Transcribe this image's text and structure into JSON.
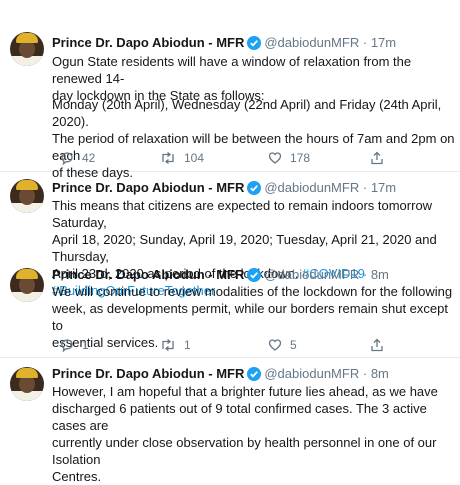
{
  "tweets": [
    {
      "name": "Prince Dr. Dapo Abiodun - MFR",
      "handle": "@dabiodunMFR",
      "sep": "·",
      "time": "17m",
      "para1": "Ogun State residents will have a window of relaxation from the renewed 14-\nday lockdown in the State as follows:",
      "para2": "Monday (20th April), Wednesday (22nd April) and Friday (24th April, 2020).\nThe period of relaxation will be between the hours of 7am and 2pm on each\nof these days.",
      "replies": "42",
      "retweets": "104",
      "likes": "178"
    },
    {
      "name": "Prince Dr. Dapo Abiodun - MFR",
      "handle": "@dabiodunMFR",
      "sep": "·",
      "time": "17m",
      "text": "This means that citizens are expected to remain indoors tomorrow Saturday,\nApril 18, 2020; Sunday, April 19, 2020; Tuesday, April 21, 2020 and Thursday,\nApril 23rd, 2020 as period of the lockdown. ",
      "hashtag1": "#COVID19",
      "hashtag2": "#BuildingOurFutureTogether"
    },
    {
      "name": "Prince Dr. Dapo Abiodun - MFR",
      "handle": "@dabiodunMFR",
      "sep": "·",
      "time": "8m",
      "text": "We will continue to review modalities of the lockdown for the following\nweek, as developments permit, while our borders remain shut except to\nessential services.",
      "replies": "1",
      "retweets": "1",
      "likes": "5"
    },
    {
      "name": "Prince Dr. Dapo Abiodun - MFR",
      "handle": "@dabiodunMFR",
      "sep": "·",
      "time": "8m",
      "text": "However, I am hopeful that a brighter future lies ahead, as we have\ndischarged 6 patients out of 9 total confirmed cases. The 3 active cases are\ncurrently under close observation by health personnel in one of our Isolation\nCentres."
    }
  ],
  "colors": {
    "verified": "#1da1f2",
    "link": "#1b95e0",
    "muted": "#657786",
    "text": "#14171a"
  }
}
